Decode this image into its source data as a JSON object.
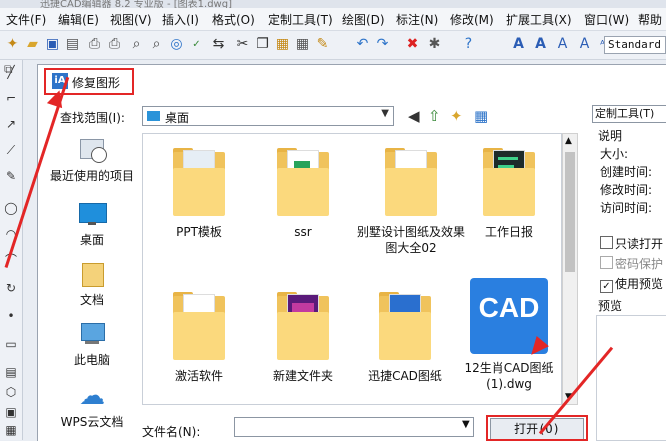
{
  "titlebar": {
    "text": "迅捷CAD编辑器 8.2 专业版 - [图表1.dwg]"
  },
  "menu": [
    "文件(F)",
    "编辑(E)",
    "视图(V)",
    "插入(I)",
    "格式(O)",
    "定制工具(T)",
    "绘图(D)",
    "标注(N)",
    "修改(M)",
    "扩展工具(X)",
    "窗口(W)",
    "帮助"
  ],
  "toolbar": {
    "style_value": "Standard"
  },
  "dialog": {
    "title": "修复图形",
    "look_in_label": "查找范围(I):",
    "look_in_value": "桌面",
    "file_name_label": "文件名(N):",
    "file_name_value": "",
    "open_button": "打开(O)"
  },
  "places": [
    {
      "label": "最近使用的项目",
      "icon": "recent-icon"
    },
    {
      "label": "桌面",
      "icon": "desktop-icon"
    },
    {
      "label": "文档",
      "icon": "documents-icon"
    },
    {
      "label": "此电脑",
      "icon": "computer-icon"
    },
    {
      "label": "WPS云文档",
      "icon": "cloud-icon"
    }
  ],
  "files": [
    {
      "name": "PPT模板",
      "kind": "folder"
    },
    {
      "name": "ssr",
      "kind": "folder"
    },
    {
      "name": "别墅设计图纸及效果图大全02",
      "kind": "folder"
    },
    {
      "name": "工作日报",
      "kind": "folder"
    },
    {
      "name": "激活软件",
      "kind": "folder"
    },
    {
      "name": "新建文件夹",
      "kind": "folder"
    },
    {
      "name": "迅捷CAD图纸",
      "kind": "folder"
    },
    {
      "name": "12生肖CAD图纸(1).dwg",
      "kind": "dwg",
      "badge": "CAD"
    }
  ],
  "right_panel": {
    "custom_tools": "定制工具(T)",
    "section_title": "说明",
    "fields": [
      "大小:",
      "创建时间:",
      "修改时间:",
      "访问时间:"
    ],
    "options": [
      {
        "label": "只读打开",
        "checked": false
      },
      {
        "label": "密码保护",
        "checked": false
      },
      {
        "label": "使用预览",
        "checked": true
      }
    ],
    "preview_label": "预览"
  },
  "colors": {
    "highlight": "#e32626",
    "accent": "#2e74c9",
    "folder": "#fbd97d"
  }
}
